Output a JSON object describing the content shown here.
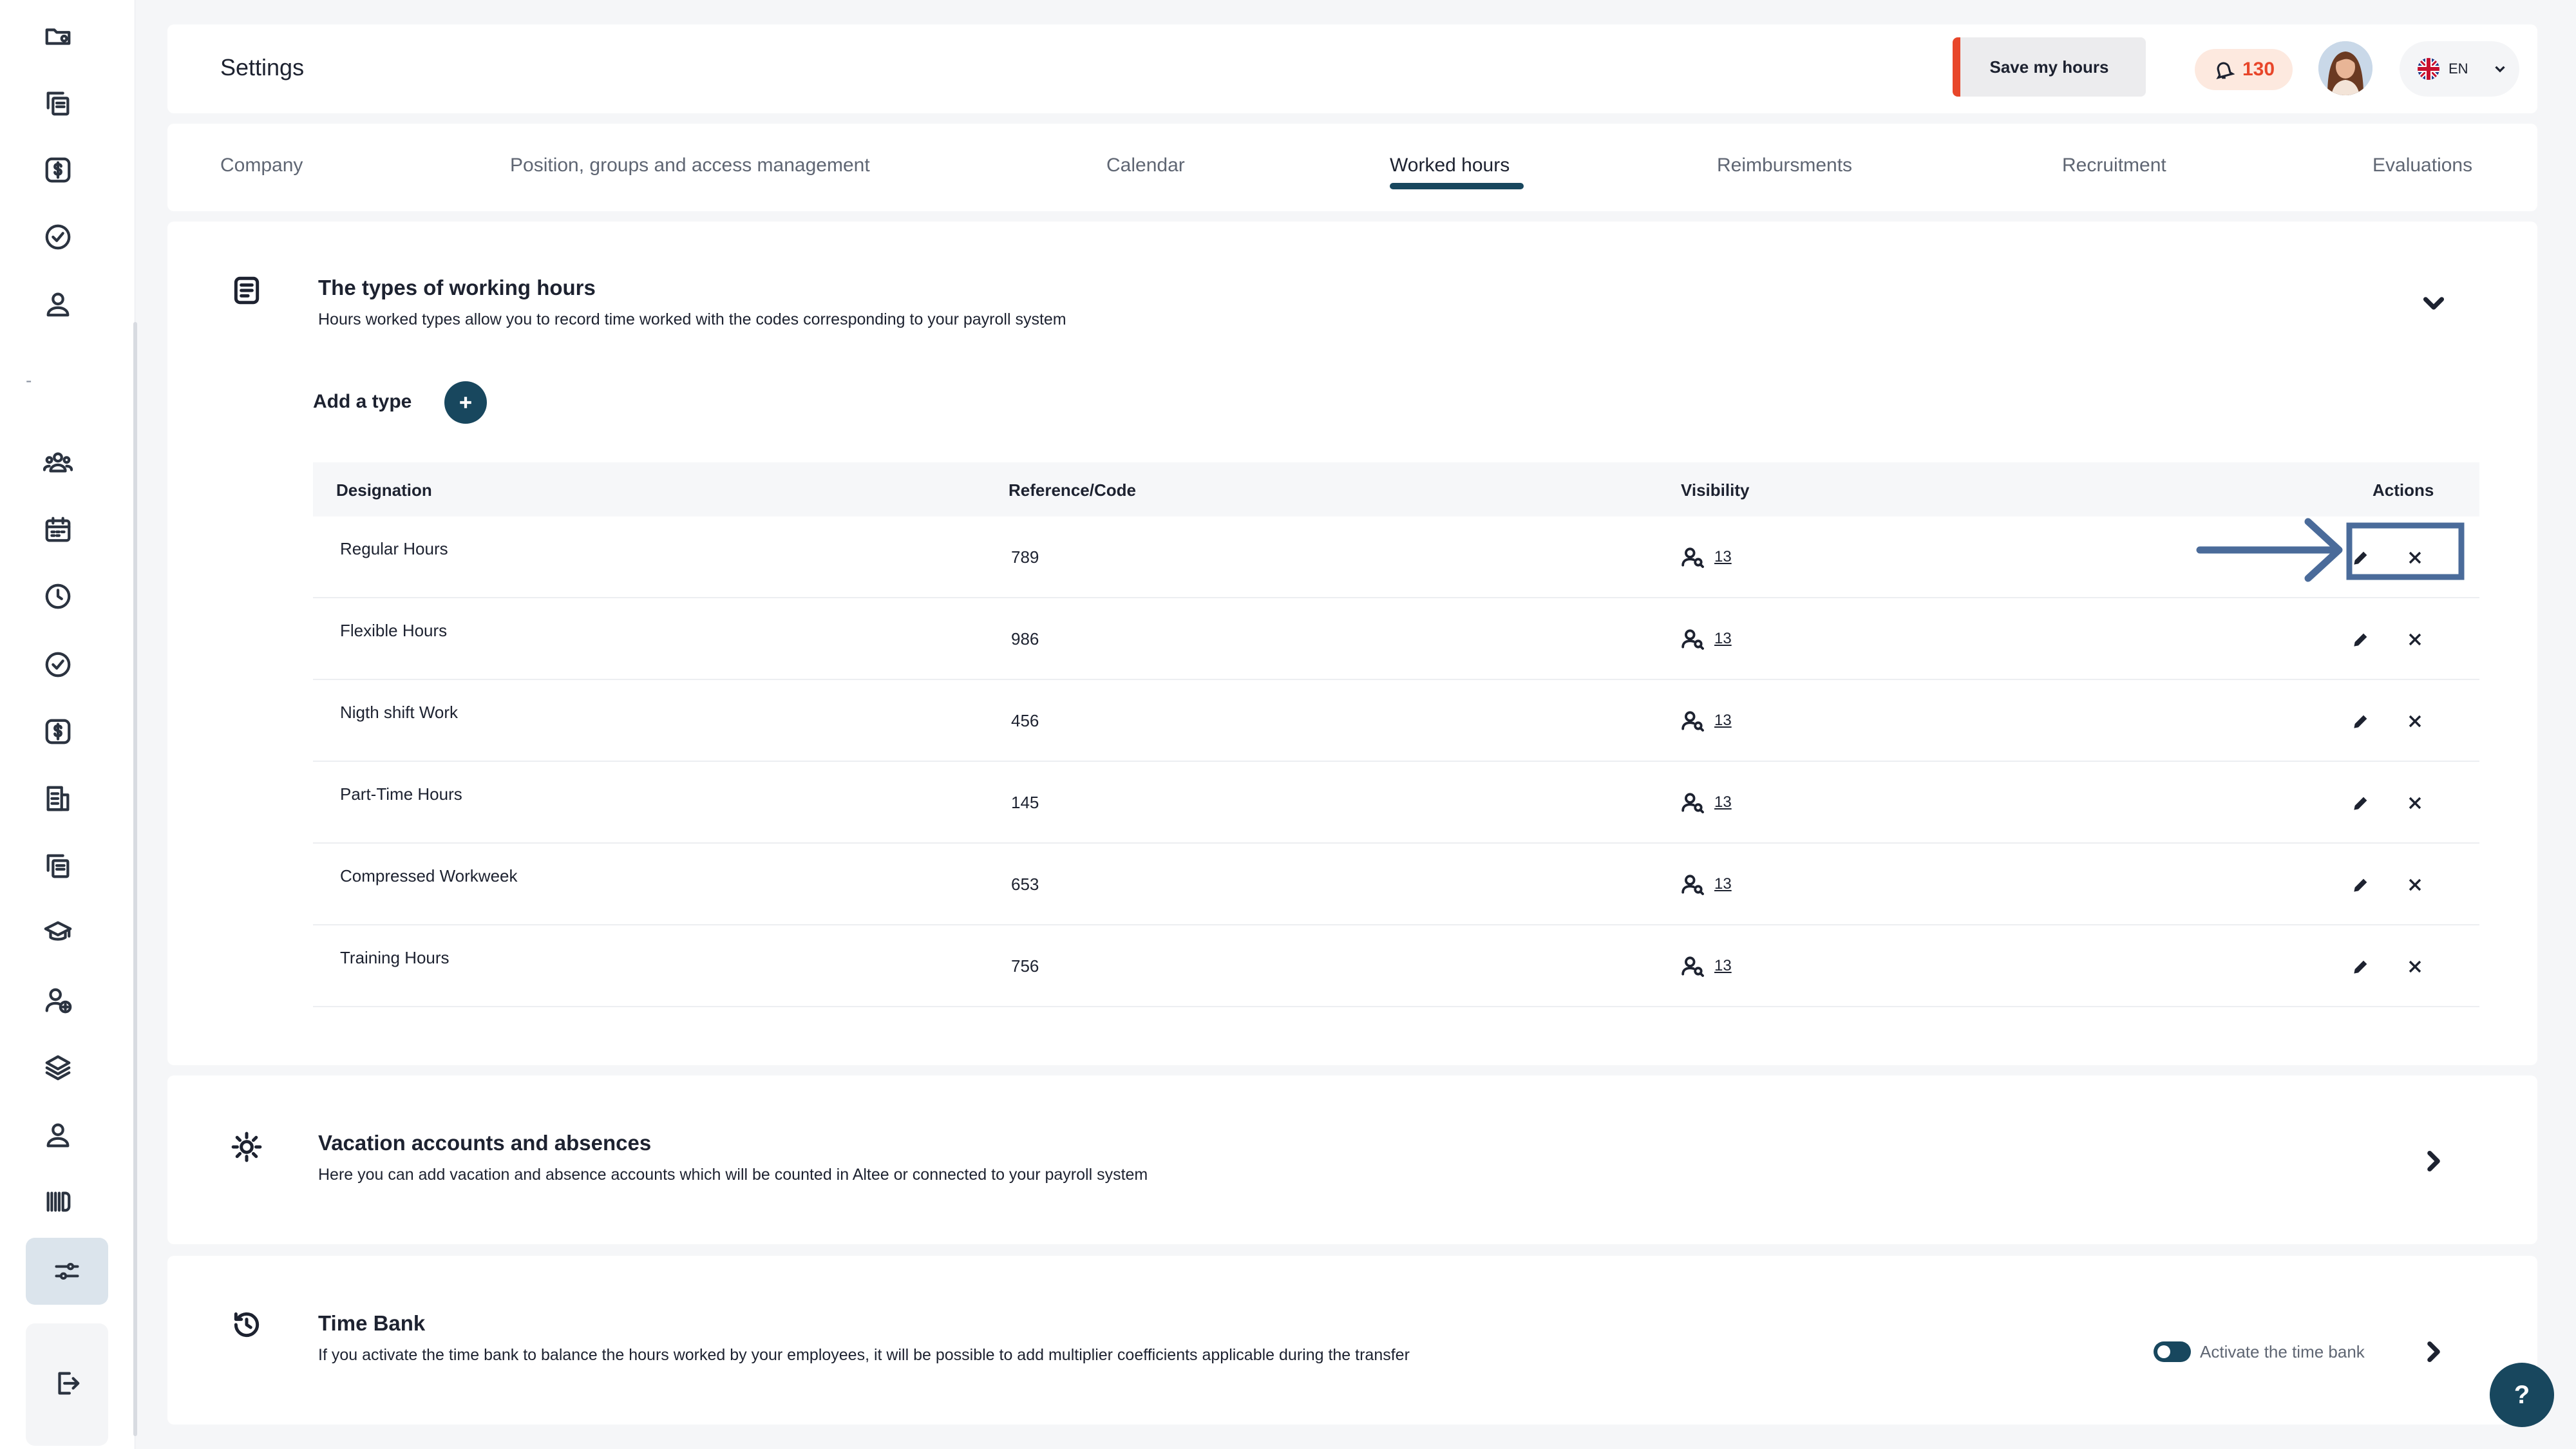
{
  "header": {
    "title": "Settings",
    "save_label": "Save my hours",
    "notifications_count": "130",
    "language": "EN"
  },
  "tabs": [
    {
      "label": "Company"
    },
    {
      "label": "Position, groups and access management"
    },
    {
      "label": "Calendar"
    },
    {
      "label": "Worked hours",
      "active": true
    },
    {
      "label": "Reimbursments"
    },
    {
      "label": "Recruitment"
    },
    {
      "label": "Evaluations"
    }
  ],
  "working_hours": {
    "title": "The types of working hours",
    "description": "Hours worked types allow you to record time worked with the codes corresponding to your payroll system",
    "add_label": "Add a type",
    "columns": {
      "designation": "Designation",
      "code": "Reference/Code",
      "visibility": "Visibility",
      "actions": "Actions"
    },
    "rows": [
      {
        "name": "Regular Hours",
        "code": "789",
        "visibility": "13"
      },
      {
        "name": "Flexible Hours",
        "code": "986",
        "visibility": "13"
      },
      {
        "name": "Nigth shift Work",
        "code": "456",
        "visibility": "13"
      },
      {
        "name": "Part-Time Hours",
        "code": "145",
        "visibility": "13"
      },
      {
        "name": "Compressed Workweek",
        "code": "653",
        "visibility": "13"
      },
      {
        "name": "Training Hours",
        "code": "756",
        "visibility": "13"
      }
    ]
  },
  "vacation": {
    "title": "Vacation accounts and absences",
    "description": "Here you can add vacation and absence accounts which will be counted in Altee or connected to your payroll system"
  },
  "time_bank": {
    "title": "Time Bank",
    "description": "If you activate the time bank to balance the hours worked by your employees, it will be possible to add multiplier coefficients applicable during the transfer",
    "toggle_label": "Activate the time bank"
  },
  "help_label": "?",
  "colors": {
    "accent": "#18475e",
    "brand_orange": "#e8462a",
    "annotation": "#4a6b9a"
  }
}
